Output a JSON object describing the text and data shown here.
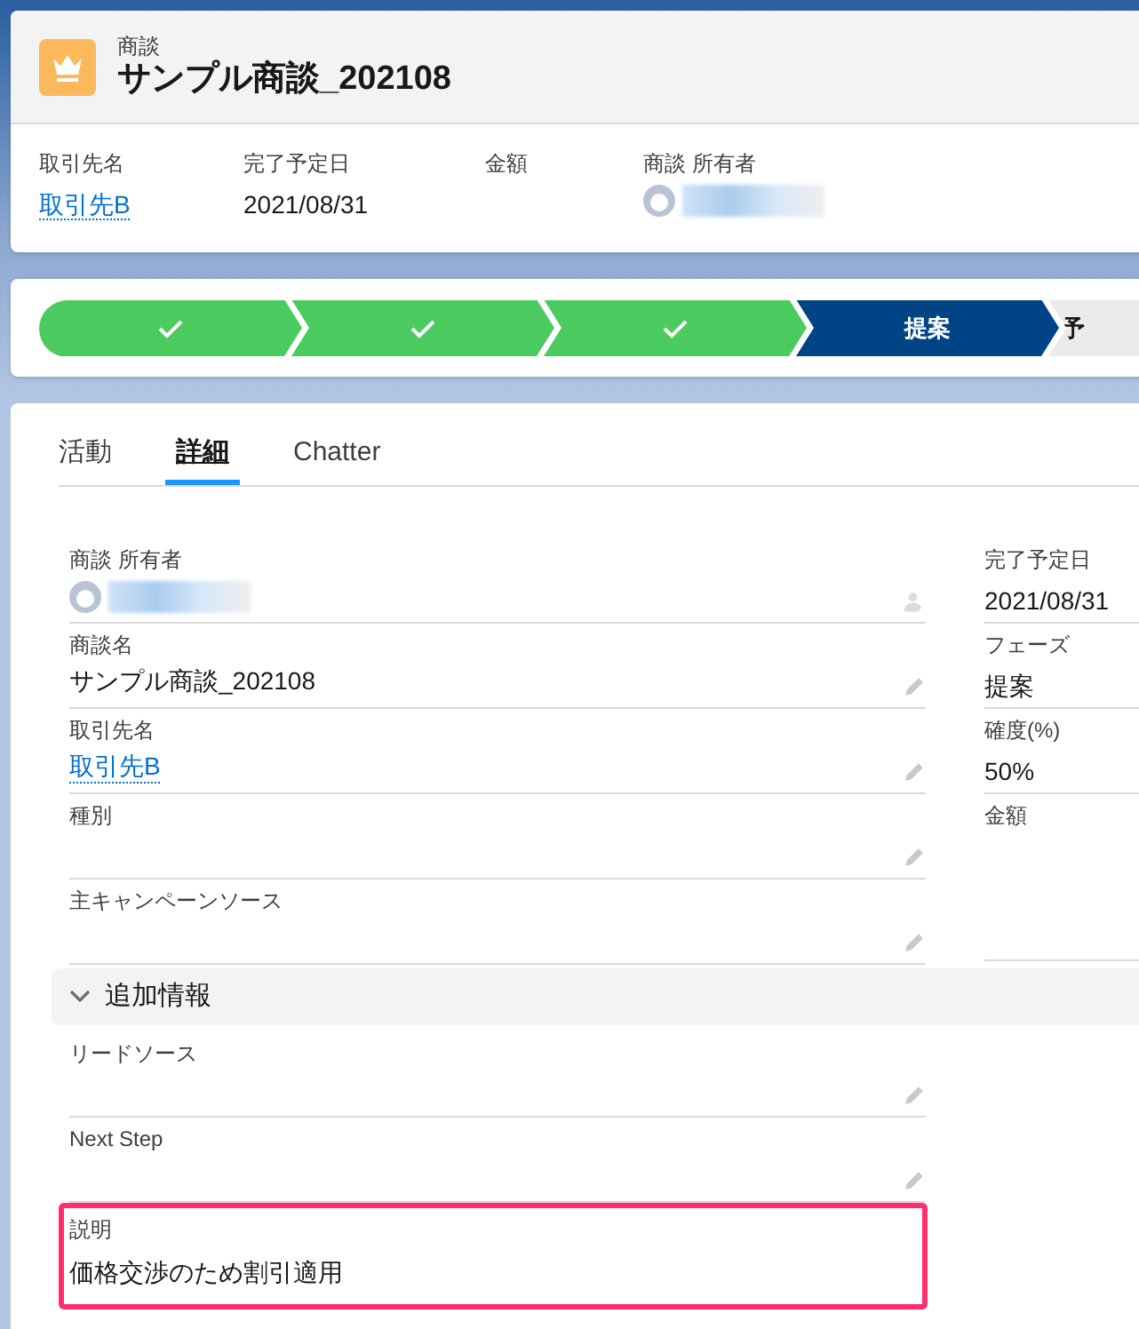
{
  "header": {
    "object_label": "商談",
    "title": "サンプル商談_202108",
    "highlights": [
      {
        "kind": "link",
        "label": "取引先名",
        "value": "取引先B"
      },
      {
        "kind": "text",
        "label": "完了予定日",
        "value": "2021/08/31"
      },
      {
        "kind": "text",
        "label": "金額"
      },
      {
        "kind": "user",
        "label": "商談 所有者"
      }
    ]
  },
  "path": [
    {
      "complete": true,
      "selected": false
    },
    {
      "complete": true,
      "selected": false
    },
    {
      "complete": true,
      "selected": false
    },
    {
      "complete": false,
      "selected": true,
      "label": "提案"
    },
    {
      "complete": false,
      "selected": false,
      "label": "予"
    }
  ],
  "tabs": [
    {
      "label": "活動",
      "selected": false
    },
    {
      "label": "詳細",
      "selected": true
    },
    {
      "label": "Chatter",
      "selected": false
    }
  ],
  "left_fields": [
    {
      "kind": "user",
      "label": "商談 所有者"
    },
    {
      "kind": "text",
      "label": "商談名",
      "value": "サンプル商談_202108"
    },
    {
      "kind": "link",
      "label": "取引先名",
      "value": "取引先B"
    },
    {
      "kind": "text",
      "label": "種別"
    },
    {
      "kind": "text",
      "label": "主キャンペーンソース"
    }
  ],
  "right_fields": [
    {
      "label": "完了予定日",
      "value": "2021/08/31"
    },
    {
      "label": "フェーズ",
      "value": "提案"
    },
    {
      "label": "確度(%)",
      "value": "50%"
    },
    {
      "label": "金額"
    }
  ],
  "section": {
    "title": "追加情報",
    "expanded": true,
    "fields": [
      {
        "label": "リードソース",
        "highlighted": false
      },
      {
        "label": "Next Step",
        "highlighted": false
      },
      {
        "label": "説明",
        "value": "価格交渉のため割引適用",
        "highlighted": true
      }
    ]
  }
}
